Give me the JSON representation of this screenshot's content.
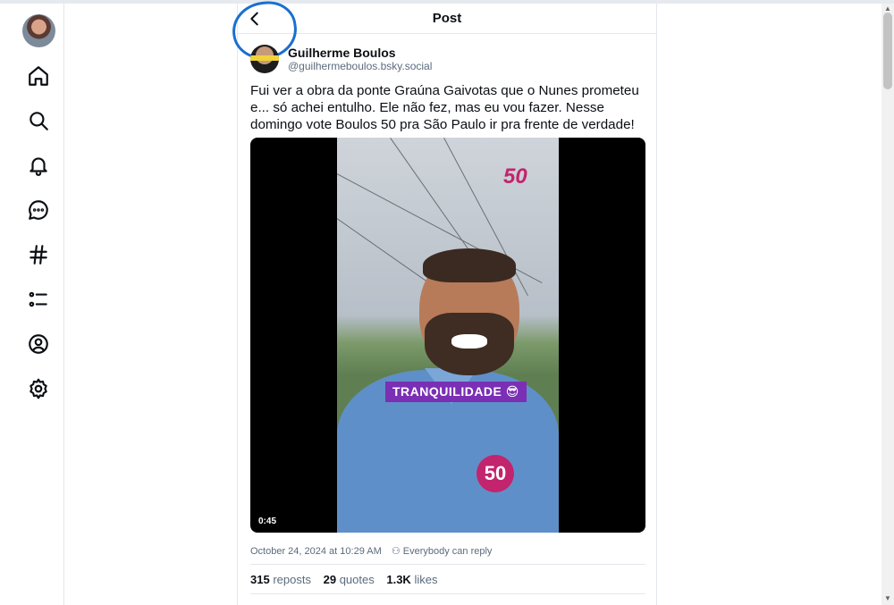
{
  "header": {
    "title": "Post"
  },
  "nav": {
    "items": [
      {
        "name": "home-icon"
      },
      {
        "name": "search-icon"
      },
      {
        "name": "bell-icon"
      },
      {
        "name": "chat-icon"
      },
      {
        "name": "hashtag-icon"
      },
      {
        "name": "list-icon"
      },
      {
        "name": "profile-icon"
      },
      {
        "name": "settings-icon"
      }
    ]
  },
  "post": {
    "author_name": "Guilherme Boulos",
    "author_handle": "@guilhermeboulos.bsky.social",
    "text": "Fui ver a obra da ponte Graúna Gaivotas que o Nunes prometeu e... só achei entulho. Ele não fez, mas eu vou fazer. Nesse domingo vote Boulos 50 pra São Paulo ir pra frente de verdade!",
    "video": {
      "duration": "0:45",
      "caption": "TRANQUILIDADE 😎",
      "logo": "50",
      "badge": "50"
    },
    "timestamp": "October 24, 2024 at 10:29 AM",
    "reply_setting": "Everybody can reply",
    "reposts_count": "315",
    "reposts_label": "reposts",
    "quotes_count": "29",
    "quotes_label": "quotes",
    "likes_count": "1.3K",
    "likes_label": "likes"
  },
  "colors": {
    "annotation_circle": "#1a6fd1",
    "campaign_pink": "#c2246e",
    "caption_purple": "#7a2fb5"
  }
}
